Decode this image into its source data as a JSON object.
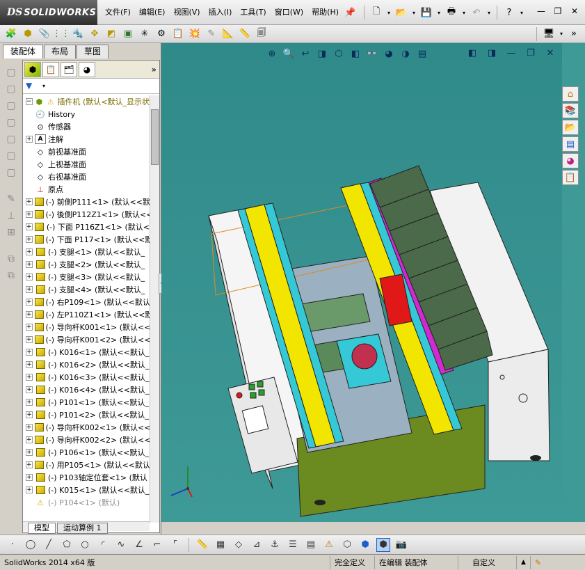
{
  "app": {
    "logo_mark": "DS",
    "logo_text": "SOLIDWORKS"
  },
  "menu": {
    "items": [
      "文件(F)",
      "编辑(E)",
      "视图(V)",
      "插入(I)",
      "工具(T)",
      "窗口(W)",
      "帮助(H)"
    ]
  },
  "left_panel": {
    "tabs": [
      "装配体",
      "布局",
      "草图"
    ],
    "bottom_tabs": [
      "模型",
      "运动算例 1"
    ]
  },
  "tree": {
    "root_label": "插件机 (默认<默认_显示状",
    "items": [
      {
        "label": "History",
        "icon": "history-icon",
        "expand": ""
      },
      {
        "label": "传感器",
        "icon": "sensor-icon",
        "expand": ""
      },
      {
        "label": "注解",
        "icon": "annotation-icon",
        "expand": "+"
      },
      {
        "label": "前视基准面",
        "icon": "plane-icon",
        "expand": ""
      },
      {
        "label": "上视基准面",
        "icon": "plane-icon",
        "expand": ""
      },
      {
        "label": "右视基准面",
        "icon": "plane-icon",
        "expand": ""
      },
      {
        "label": "原点",
        "icon": "origin-icon",
        "expand": ""
      },
      {
        "label": "(-) 前側P111<1> (默认<<默",
        "icon": "part-icon",
        "expand": "+"
      },
      {
        "label": "(-) 後側P112Z1<1> (默认<<",
        "icon": "part-icon",
        "expand": "+"
      },
      {
        "label": "(-) 下面 P116Z1<1> (默认<",
        "icon": "part-icon",
        "expand": "+"
      },
      {
        "label": "(-) 下面 P117<1> (默认<<默",
        "icon": "part-icon",
        "expand": "+"
      },
      {
        "label": "(-) 支腿<1> (默认<<默认_",
        "icon": "part-icon",
        "expand": "+"
      },
      {
        "label": "(-) 支腿<2> (默认<<默认_",
        "icon": "part-icon",
        "expand": "+"
      },
      {
        "label": "(-) 支腿<3> (默认<<默认_",
        "icon": "part-icon",
        "expand": "+"
      },
      {
        "label": "(-) 支腿<4> (默认<<默认_",
        "icon": "part-icon",
        "expand": "+"
      },
      {
        "label": "(-) 右P109<1> (默认<<默认",
        "icon": "part-icon",
        "expand": "+"
      },
      {
        "label": "(-) 左P110Z1<1> (默认<<默",
        "icon": "part-icon",
        "expand": "+"
      },
      {
        "label": "(-) 导向杆K001<1> (默认<<",
        "icon": "part-icon",
        "expand": "+"
      },
      {
        "label": "(-) 导向杆K001<2> (默认<<",
        "icon": "part-icon",
        "expand": "+"
      },
      {
        "label": "(-) K016<1> (默认<<默认_",
        "icon": "part-icon",
        "expand": "+"
      },
      {
        "label": "(-) K016<2> (默认<<默认_",
        "icon": "part-icon",
        "expand": "+"
      },
      {
        "label": "(-) K016<3> (默认<<默认_",
        "icon": "part-icon",
        "expand": "+"
      },
      {
        "label": "(-) K016<4> (默认<<默认_",
        "icon": "part-icon",
        "expand": "+"
      },
      {
        "label": "(-) P101<1> (默认<<默认_",
        "icon": "part-icon",
        "expand": "+"
      },
      {
        "label": "(-) P101<2> (默认<<默认_",
        "icon": "part-icon",
        "expand": "+"
      },
      {
        "label": "(-) 导向杆K002<1> (默认<<",
        "icon": "part-icon",
        "expand": "+"
      },
      {
        "label": "(-) 导向杆K002<2> (默认<<",
        "icon": "part-icon",
        "expand": "+"
      },
      {
        "label": "(-) P106<1> (默认<<默认_",
        "icon": "part-icon",
        "expand": "+"
      },
      {
        "label": "(-) 用P105<1> (默认<<默认",
        "icon": "part-icon",
        "expand": "+"
      },
      {
        "label": "(-) P103轴定位套<1> (默认",
        "icon": "part-icon",
        "expand": "+"
      },
      {
        "label": "(-) K015<1> (默认<<默认_",
        "icon": "part-icon",
        "expand": "+"
      },
      {
        "label": "(-) P104<1> (默认)",
        "icon": "warning-icon",
        "expand": "",
        "suppressed": true
      }
    ]
  },
  "status": {
    "version": "SolidWorks 2014 x64 版",
    "defined": "完全定义",
    "editing": "在编辑 装配体",
    "custom": "自定义"
  },
  "colors": {
    "viewport_bg": "#3e9a96",
    "frame_yellow": "#f2e600",
    "rail_cyan": "#35c8d6",
    "panel_green": "#6b8a1f",
    "magenta": "#d12ad1",
    "red_block": "#e01818"
  }
}
